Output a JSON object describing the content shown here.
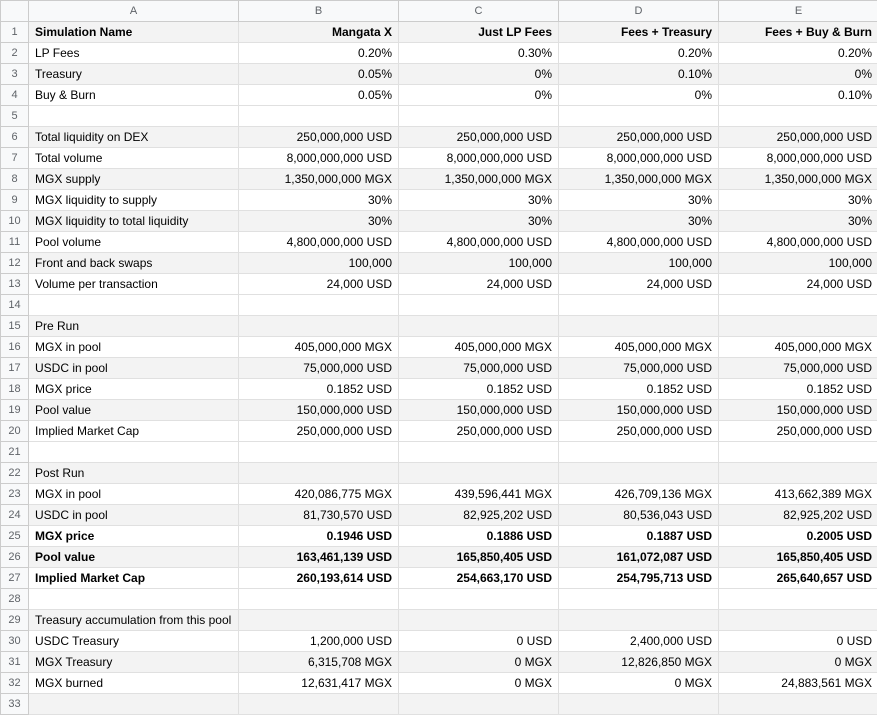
{
  "chart_data": {
    "type": "table",
    "columns": [
      "A",
      "B",
      "C",
      "D",
      "E"
    ],
    "row_formats": {
      "bold_rows": [
        1,
        25,
        26,
        27
      ],
      "banded_rows": [
        1,
        3,
        6,
        8,
        10,
        12,
        15,
        17,
        19,
        22,
        24,
        26,
        29,
        31,
        33
      ]
    },
    "rows": [
      {
        "n": 1,
        "A": "Simulation Name",
        "B": "Mangata X",
        "C": "Just LP Fees",
        "D": "Fees + Treasury",
        "E": "Fees + Buy & Burn"
      },
      {
        "n": 2,
        "A": "LP Fees",
        "B": "0.20%",
        "C": "0.30%",
        "D": "0.20%",
        "E": "0.20%"
      },
      {
        "n": 3,
        "A": "Treasury",
        "B": "0.05%",
        "C": "0%",
        "D": "0.10%",
        "E": "0%"
      },
      {
        "n": 4,
        "A": "Buy & Burn",
        "B": "0.05%",
        "C": "0%",
        "D": "0%",
        "E": "0.10%"
      },
      {
        "n": 5,
        "A": "",
        "B": "",
        "C": "",
        "D": "",
        "E": ""
      },
      {
        "n": 6,
        "A": "Total liquidity on DEX",
        "B": "250,000,000 USD",
        "C": "250,000,000 USD",
        "D": "250,000,000 USD",
        "E": "250,000,000 USD"
      },
      {
        "n": 7,
        "A": "Total volume",
        "B": "8,000,000,000 USD",
        "C": "8,000,000,000 USD",
        "D": "8,000,000,000 USD",
        "E": "8,000,000,000 USD"
      },
      {
        "n": 8,
        "A": "MGX supply",
        "B": "1,350,000,000 MGX",
        "C": "1,350,000,000 MGX",
        "D": "1,350,000,000 MGX",
        "E": "1,350,000,000 MGX"
      },
      {
        "n": 9,
        "A": "MGX liquidity to supply",
        "B": "30%",
        "C": "30%",
        "D": "30%",
        "E": "30%"
      },
      {
        "n": 10,
        "A": "MGX liquidity to total liquidity",
        "B": "30%",
        "C": "30%",
        "D": "30%",
        "E": "30%"
      },
      {
        "n": 11,
        "A": "Pool volume",
        "B": "4,800,000,000 USD",
        "C": "4,800,000,000 USD",
        "D": "4,800,000,000 USD",
        "E": "4,800,000,000 USD"
      },
      {
        "n": 12,
        "A": "Front and back swaps",
        "B": "100,000",
        "C": "100,000",
        "D": "100,000",
        "E": "100,000"
      },
      {
        "n": 13,
        "A": "Volume per transaction",
        "B": "24,000 USD",
        "C": "24,000 USD",
        "D": "24,000 USD",
        "E": "24,000 USD"
      },
      {
        "n": 14,
        "A": "",
        "B": "",
        "C": "",
        "D": "",
        "E": ""
      },
      {
        "n": 15,
        "A": "Pre Run",
        "B": "",
        "C": "",
        "D": "",
        "E": ""
      },
      {
        "n": 16,
        "A": "MGX  in pool",
        "B": "405,000,000 MGX",
        "C": "405,000,000 MGX",
        "D": "405,000,000 MGX",
        "E": "405,000,000 MGX"
      },
      {
        "n": 17,
        "A": "USDC in pool",
        "B": "75,000,000 USD",
        "C": "75,000,000 USD",
        "D": "75,000,000 USD",
        "E": "75,000,000 USD"
      },
      {
        "n": 18,
        "A": "MGX price",
        "B": "0.1852 USD",
        "C": "0.1852 USD",
        "D": "0.1852 USD",
        "E": "0.1852 USD"
      },
      {
        "n": 19,
        "A": "Pool value",
        "B": "150,000,000 USD",
        "C": "150,000,000 USD",
        "D": "150,000,000 USD",
        "E": "150,000,000 USD"
      },
      {
        "n": 20,
        "A": "Implied Market Cap",
        "B": "250,000,000 USD",
        "C": "250,000,000 USD",
        "D": "250,000,000 USD",
        "E": "250,000,000 USD"
      },
      {
        "n": 21,
        "A": "",
        "B": "",
        "C": "",
        "D": "",
        "E": ""
      },
      {
        "n": 22,
        "A": "Post Run",
        "B": "",
        "C": "",
        "D": "",
        "E": ""
      },
      {
        "n": 23,
        "A": "MGX  in pool",
        "B": "420,086,775 MGX",
        "C": "439,596,441 MGX",
        "D": "426,709,136 MGX",
        "E": "413,662,389 MGX"
      },
      {
        "n": 24,
        "A": "USDC in pool",
        "B": "81,730,570 USD",
        "C": "82,925,202 USD",
        "D": "80,536,043 USD",
        "E": "82,925,202 USD"
      },
      {
        "n": 25,
        "A": "MGX price",
        "B": "0.1946 USD",
        "C": "0.1886 USD",
        "D": "0.1887 USD",
        "E": "0.2005 USD"
      },
      {
        "n": 26,
        "A": "Pool value",
        "B": "163,461,139 USD",
        "C": "165,850,405 USD",
        "D": "161,072,087 USD",
        "E": "165,850,405 USD"
      },
      {
        "n": 27,
        "A": "Implied Market Cap",
        "B": "260,193,614 USD",
        "C": "254,663,170 USD",
        "D": "254,795,713 USD",
        "E": "265,640,657 USD"
      },
      {
        "n": 28,
        "A": "",
        "B": "",
        "C": "",
        "D": "",
        "E": ""
      },
      {
        "n": 29,
        "A": "Treasury accumulation from this pool",
        "B": "",
        "C": "",
        "D": "",
        "E": ""
      },
      {
        "n": 30,
        "A": "USDC Treasury",
        "B": "1,200,000 USD",
        "C": "0 USD",
        "D": "2,400,000 USD",
        "E": "0 USD"
      },
      {
        "n": 31,
        "A": "MGX Treasury",
        "B": "6,315,708 MGX",
        "C": "0 MGX",
        "D": "12,826,850 MGX",
        "E": "0 MGX"
      },
      {
        "n": 32,
        "A": "MGX burned",
        "B": "12,631,417 MGX",
        "C": "0 MGX",
        "D": "0 MGX",
        "E": "24,883,561 MGX"
      },
      {
        "n": 33,
        "A": "",
        "B": "",
        "C": "",
        "D": "",
        "E": ""
      }
    ]
  }
}
